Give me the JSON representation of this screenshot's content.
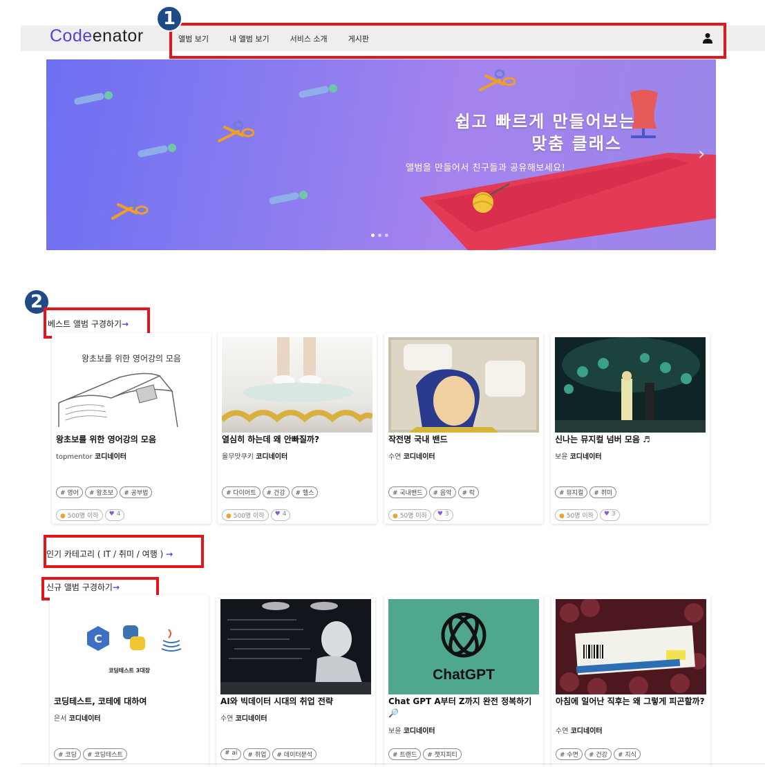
{
  "header": {
    "logo_part1": "Code",
    "logo_part2": "enator",
    "nav": [
      "앨범 보기",
      "내 앨범 보기",
      "서비스 소개",
      "게시판"
    ],
    "user_icon": "user-icon"
  },
  "annotations": {
    "badge1": "1",
    "badge2": "2"
  },
  "hero": {
    "title_line1": "쉽고 빠르게 만들어보는",
    "title_line2": "맞춤 클래스",
    "subtitle": "앨범을 만들어서 친구들과 공유해보세요!",
    "next_icon": "chevron-right-icon",
    "slides": 3,
    "active_slide": 1
  },
  "sections": {
    "best": "베스트 앨범 구경하기",
    "popular": "인기 카테고리 ( IT / 취미 / 여행 )",
    "new": "신규 앨범 구경하기",
    "arrow": "→"
  },
  "best_cards": [
    {
      "thumb_text": "왕초보를 위한 영어강의 모음",
      "title": "왕초보를 위한 영어강의 모음",
      "author": "topmentor",
      "brand": "코디네이터",
      "tags": [
        "# 영어",
        "# 왕초보",
        "# 공부법"
      ],
      "members": "500명 이하",
      "likes": "4"
    },
    {
      "title": "열심히 하는데 왜 안빠질까?",
      "author": "율무맛쿠키",
      "brand": "코디네이터",
      "tags": [
        "# 다이어트",
        "# 건강",
        "# 헬스"
      ],
      "members": "500명 이하",
      "likes": "4"
    },
    {
      "title": "작전명 국내 밴드",
      "author": "수연",
      "brand": "코디네이터",
      "tags": [
        "# 국내밴드",
        "# 음악",
        "# 락"
      ],
      "members": "50명 이하",
      "likes": "3"
    },
    {
      "title": "신나는 뮤지컬 넘버 모음 ♬",
      "author": "보윤",
      "brand": "코디네이터",
      "tags": [
        "# 뮤지컬",
        "# 취미"
      ],
      "members": "50명 이하",
      "likes": "3"
    }
  ],
  "new_cards": [
    {
      "thumb_caption": "코딩테스트 3대장",
      "title": "코딩테스트, 코테에 대하여",
      "author": "은서",
      "brand": "코디네이터",
      "tags": [
        "# 코딩",
        "# 코딩테스트"
      ]
    },
    {
      "title": "AI와 빅데이터 시대의 취업 전략",
      "author": "수연",
      "brand": "코디네이터",
      "tags": [
        "# ai",
        "# 취업",
        "# 데이터분석"
      ]
    },
    {
      "thumb_caption": "ChatGPT",
      "title": "Chat GPT A부터 Z까지 완전 정복하기 🔎",
      "author": "보윤",
      "brand": "코디네이터",
      "tags": [
        "# 트랜드",
        "# 챗지피티"
      ]
    },
    {
      "title": "아침에 일어난 직후는 왜 그렇게 피곤할까?",
      "author": "수연",
      "brand": "코디네이터",
      "tags": [
        "# 수면",
        "# 건강",
        "# 지식"
      ]
    }
  ],
  "colors": {
    "brand": "#5b3fd1",
    "annotation": "#e5141a",
    "badge": "#1f4a85"
  }
}
